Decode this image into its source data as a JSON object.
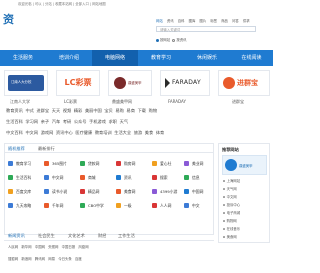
{
  "topbar": {
    "text": "欢迎光临 | 可以 | 分站 | 收藏本站网 | 全部入口 | 网站地图"
  },
  "logo": {
    "text": "资"
  },
  "search": {
    "tabs": [
      "网站",
      "资讯",
      "百科",
      "图库",
      "图片",
      "标签",
      "商品",
      "问答",
      "供求"
    ],
    "placeholder": "请输入关键词",
    "options": [
      "按网站",
      "按资讯"
    ]
  },
  "nav": {
    "items": [
      "生活服务",
      "培训介绍",
      "电脑网络",
      "教育学习",
      "休闲娱乐",
      "在线阅读"
    ],
    "active_index": 2
  },
  "logos": [
    {
      "name": "江南人大部",
      "brand": "江南人大分校",
      "label": "江南人大学"
    },
    {
      "name": "LC彩票",
      "brand": "LC购彩",
      "label": "LC彩票"
    },
    {
      "name": "鼎盛",
      "brand": "鼎盛美甲",
      "label": "鼎盛美甲网"
    },
    {
      "name": "FARADAY",
      "brand": "FARADAY",
      "label": "FARADAY"
    },
    {
      "name": "进群宝",
      "brand": "进群宝",
      "label": "进群宝"
    }
  ],
  "link_rows": [
    [
      "教育资讯",
      "中式",
      "进群宝",
      "天天",
      "视频",
      "精彩",
      "美丽中国",
      "宝贝",
      "易购",
      "易商",
      "下载",
      "购物"
    ],
    [
      "生活百科",
      "学习网",
      "亲子",
      "汽车",
      "考研",
      "公众号",
      "手机游戏",
      "求职",
      "天气"
    ],
    [
      "中文百科",
      "中文网",
      "游戏网",
      "资讯中心",
      "医疗健康",
      "教育培训",
      "生活大全",
      "旅游",
      "美食",
      "体育"
    ]
  ],
  "section": {
    "tabs": [
      "随机推荐",
      "最新排行"
    ],
    "items": [
      [
        "教育学习",
        "365图片",
        "贷款网",
        "购房网",
        "爱心社",
        "美业网"
      ],
      [
        "生活百科",
        "中文网",
        "商城",
        "资讯",
        "搜索",
        "信息"
      ],
      [
        "百度文库",
        "读书小说",
        "精品网",
        "美食网",
        "4399小游",
        "中国网"
      ],
      [
        "九天攻略",
        "千年网",
        "CBO中学",
        "一级",
        "人人网",
        "中文"
      ]
    ]
  },
  "right": {
    "title": "推荐网站",
    "banner": "鼎盛美甲",
    "list": [
      "上海网站",
      "天气网",
      "中文网",
      "投诉中心",
      "电子商城",
      "购物网",
      "在线音乐",
      "美食网"
    ]
  },
  "bottom": {
    "tabs": [
      "新闻资讯",
      "社会民生",
      "文化艺术",
      "财经",
      "工作生活"
    ],
    "rows": [
      [
        "人民网",
        "新华网",
        "中国网",
        "央视网",
        "中国日报",
        "凤凰网"
      ],
      [
        "搜狐网",
        "新浪网",
        "腾讯网",
        "网易",
        "今日头条",
        "百度"
      ]
    ]
  },
  "colors": {
    "primary": "#1f7bd1",
    "dark": "#1260ad",
    "accent": "#e95a2b"
  }
}
